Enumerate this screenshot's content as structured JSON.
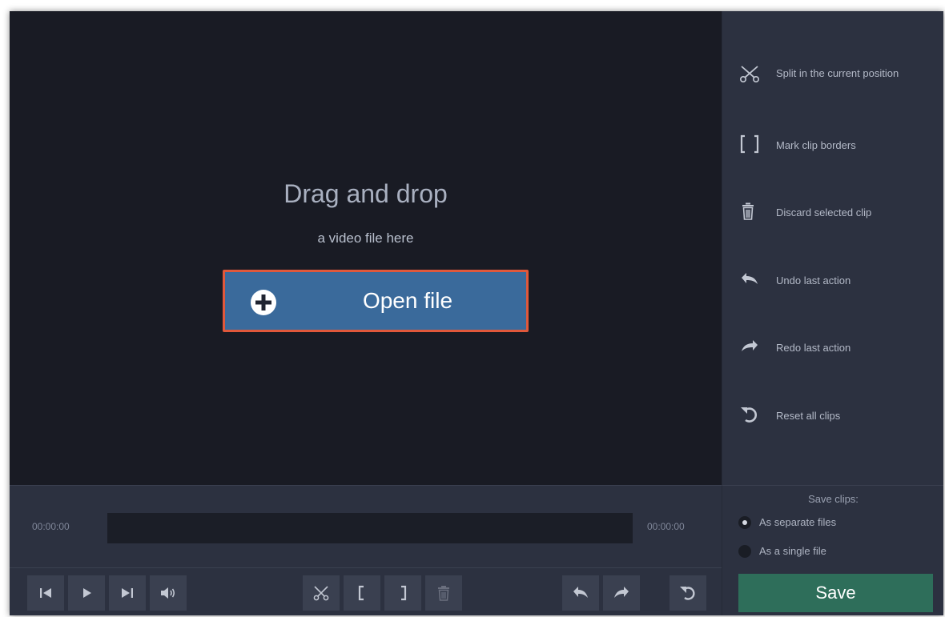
{
  "preview": {
    "title": "Drag and drop",
    "subtitle": "a video file here",
    "open_button": "Open file"
  },
  "sidebar": {
    "items": [
      {
        "label": "Split in the current position",
        "icon": "scissors-icon"
      },
      {
        "label": "Mark clip borders",
        "icon": "brackets-icon"
      },
      {
        "label": "Discard selected clip",
        "icon": "trash-icon"
      },
      {
        "label": "Undo last action",
        "icon": "undo-icon"
      },
      {
        "label": "Redo last action",
        "icon": "redo-icon"
      },
      {
        "label": "Reset all clips",
        "icon": "reset-icon"
      }
    ]
  },
  "timeline": {
    "start_time": "00:00:00",
    "end_time": "00:00:00"
  },
  "save": {
    "heading": "Save clips:",
    "options": [
      "As separate files",
      "As a single file"
    ],
    "selected": "As separate files",
    "button": "Save"
  },
  "colors": {
    "accent": "#3a6a9b",
    "highlight_border": "#e0583b",
    "save_button": "#2e6e5a"
  }
}
